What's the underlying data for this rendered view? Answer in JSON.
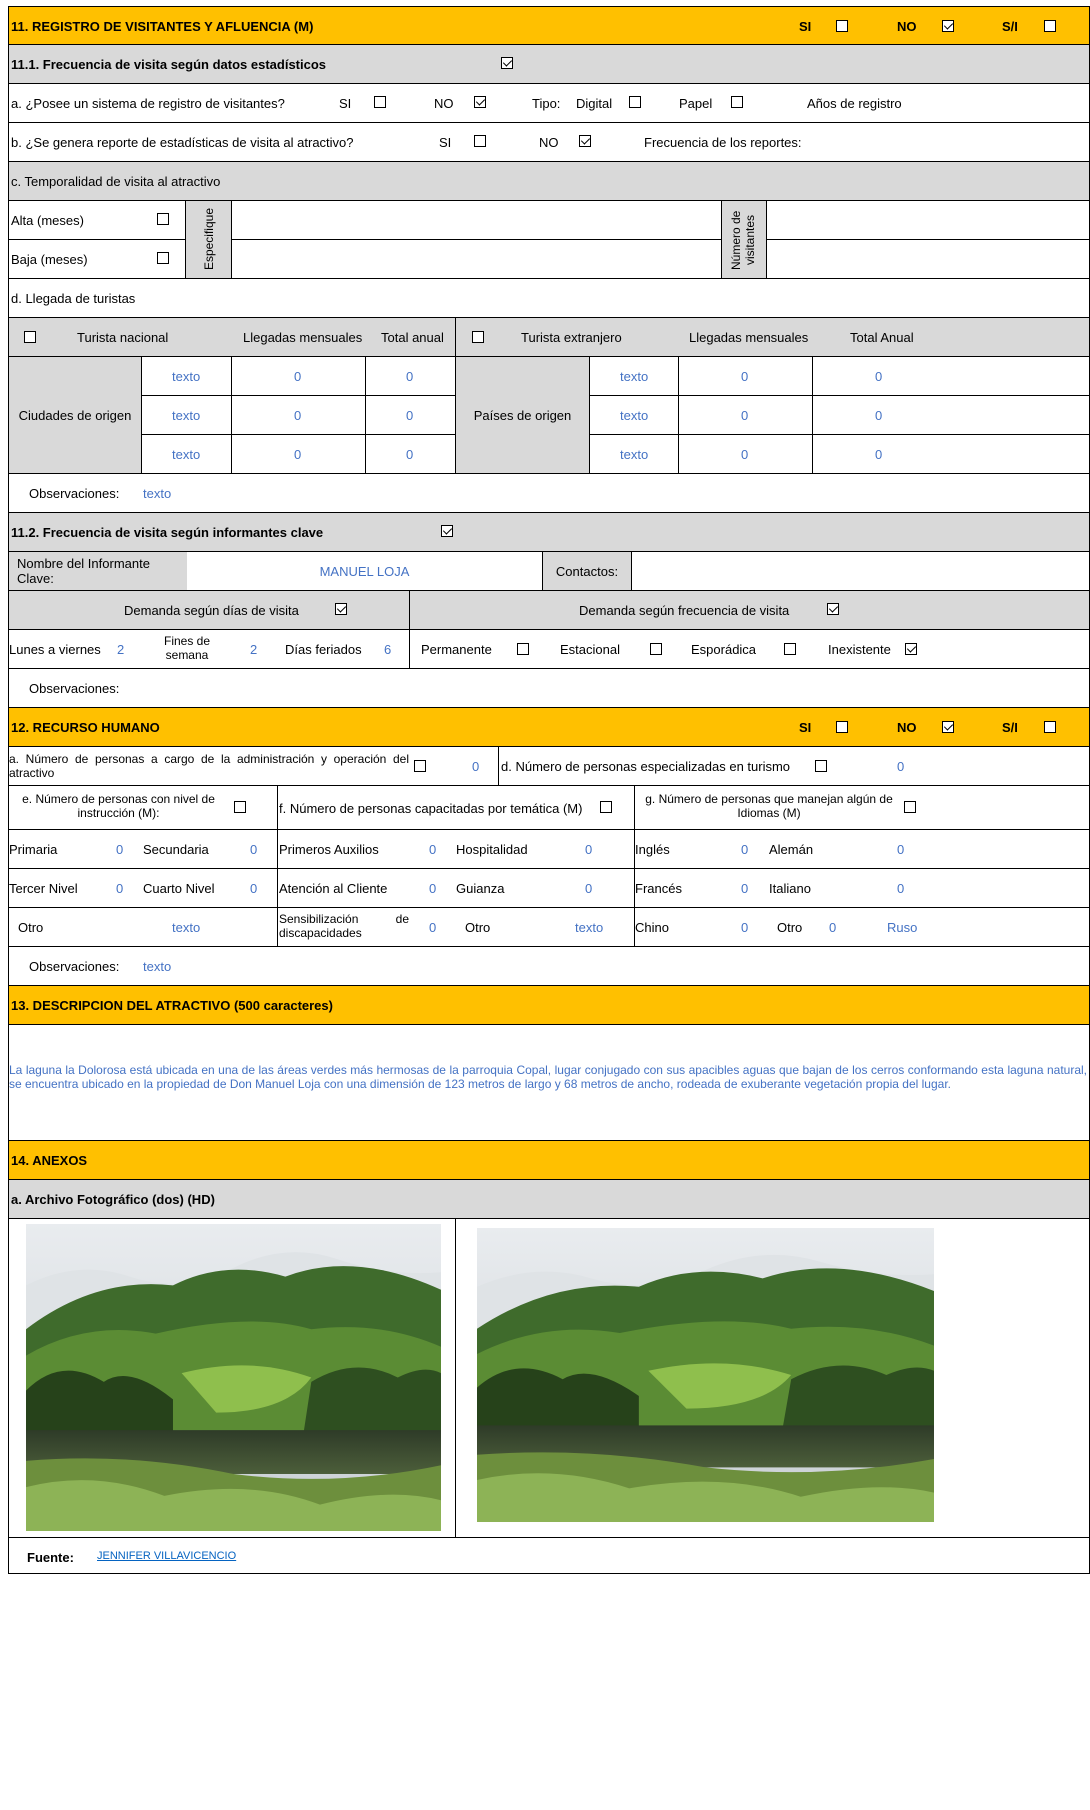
{
  "s11": {
    "title": "11. REGISTRO DE VISITANTES Y AFLUENCIA (M)",
    "si": "SI",
    "no": "NO",
    "sn": "S/I",
    "sub1": "11.1. Frecuencia de visita según datos estadísticos",
    "a_q": "a. ¿Posee un sistema de registro de visitantes?",
    "si_lbl": "SI",
    "no_lbl": "NO",
    "tipo": "Tipo:",
    "digital": "Digital",
    "papel": "Papel",
    "anios": "Años de registro",
    "b_q": "b. ¿Se genera reporte de estadísticas de visita al atractivo?",
    "freq_rep": "Frecuencia de los reportes:",
    "c_q": "c. Temporalidad de visita al atractivo",
    "alta": "Alta (meses)",
    "baja": "Baja (meses)",
    "especifique": "Especifique",
    "num_vis": "Número de visitantes",
    "d_q": "d. Llegada de turistas",
    "tur_nac": "Turista nacional",
    "lleg_mens": "Llegadas mensuales",
    "total_anual": "Total anual",
    "tur_ext": "Turista extranjero",
    "lleg_mens2": "Llegadas mensuales",
    "total_anual2": "Total Anual",
    "ciudades": "Ciudades de origen",
    "paises": "Países de origen",
    "nac_rows": [
      [
        "texto",
        "0",
        "0"
      ],
      [
        "texto",
        "0",
        "0"
      ],
      [
        "texto",
        "0",
        "0"
      ]
    ],
    "ext_rows": [
      [
        "texto",
        "0",
        "0"
      ],
      [
        "texto",
        "0",
        "0"
      ],
      [
        "texto",
        "0",
        "0"
      ]
    ],
    "obs": "Observaciones:",
    "obs_val": "texto",
    "sub2": "11.2. Frecuencia de visita según informantes clave",
    "nombre_inf": "Nombre del Informante Clave:",
    "nombre_val": "MANUEL LOJA",
    "contactos": "Contactos:",
    "dem_dias": "Demanda según  días de visita",
    "dem_freq": "Demanda según frecuencia de visita",
    "lunes": "Lunes a viernes",
    "lunes_v": "2",
    "fines": "Fines de semana",
    "fines_v": "2",
    "feriados": "Días feriados",
    "feriados_v": "6",
    "permanente": "Permanente",
    "estacional": "Estacional",
    "esporadica": "Esporádica",
    "inexistente": "Inexistente",
    "obs2": "Observaciones:"
  },
  "s12": {
    "title": "12. RECURSO HUMANO",
    "si": "SI",
    "no": "NO",
    "sn": "S/I",
    "a_q": "a. Número de personas a cargo de la administración y operación del atractivo",
    "a_v": "0",
    "d_q": "d. Número de personas especializadas en turismo",
    "d_v": "0",
    "e_q": "e. Número de personas con nivel de instrucción (M):",
    "f_q": "f. Número de personas capacitadas por temática (M)",
    "g_q": "g. Número de personas que manejan algún de Idiomas (M)",
    "primaria": "Primaria",
    "primaria_v": "0",
    "secundaria": "Secundaria",
    "secundaria_v": "0",
    "tercer": "Tercer Nivel",
    "tercer_v": "0",
    "cuarto": "Cuarto Nivel",
    "cuarto_v": "0",
    "otro": "Otro",
    "otro_v": "texto",
    "auxilios": "Primeros Auxilios",
    "auxilios_v": "0",
    "hosp": "Hospitalidad",
    "hosp_v": "0",
    "atencion": "Atención al Cliente",
    "atencion_v": "0",
    "guianza": "Guianza",
    "guianza_v": "0",
    "sens": "Sensibilización de discapacidades",
    "sens_v": "0",
    "otro2": "Otro",
    "otro2_v": "texto",
    "ingles": "Inglés",
    "ingles_v": "0",
    "aleman": "Alemán",
    "aleman_v": "0",
    "frances": "Francés",
    "frances_v": "0",
    "italiano": "Italiano",
    "italiano_v": "0",
    "chino": "Chino",
    "chino_v": "0",
    "otro3": "Otro",
    "otro3_v": "0",
    "ruso": "Ruso",
    "obs": "Observaciones:",
    "obs_val": "texto"
  },
  "s13": {
    "title": "13. DESCRIPCION DEL ATRACTIVO (500 caracteres)",
    "desc": "La laguna la Dolorosa está ubicada en una de las áreas verdes más hermosas de la parroquia Copal, lugar conjugado con sus apacibles aguas que bajan de los cerros conformando esta laguna natural, se encuentra ubicado en la propiedad de Don Manuel Loja con una dimensión de 123 metros de largo y 68 metros de ancho, rodeada de exuberante vegetación propia del lugar."
  },
  "s14": {
    "title": "14. ANEXOS",
    "sub": "a. Archivo Fotográfico (dos) (HD)",
    "fuente": "Fuente:",
    "fuente_val": "JENNIFER VILLAVICENCIO"
  }
}
